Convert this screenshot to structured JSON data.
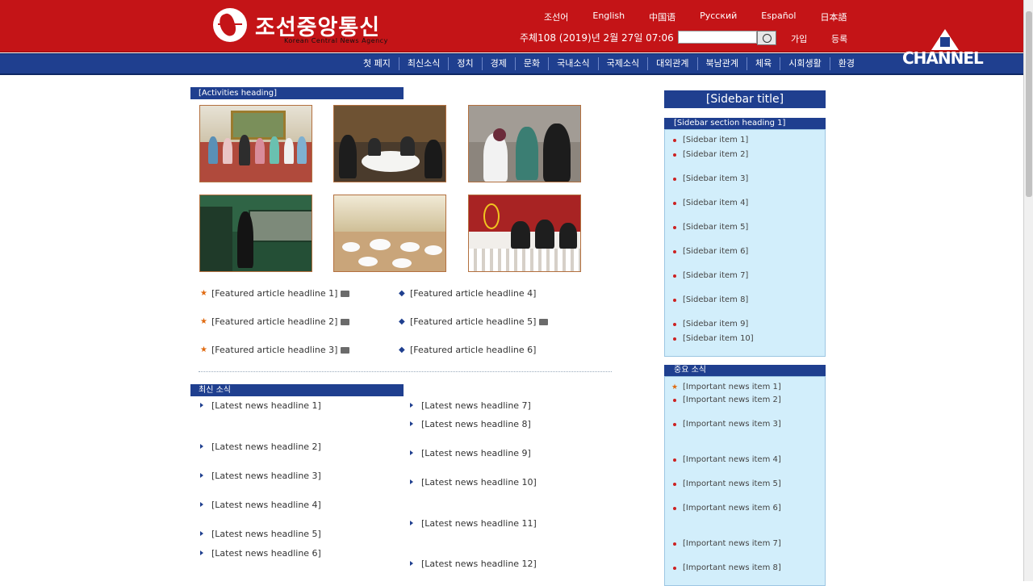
{
  "header": {
    "site_title": "조선중앙통신",
    "site_subtitle": "Korean Central News Agency",
    "languages": [
      "조선어",
      "English",
      "中国语",
      "Русский",
      "Español",
      "日本語"
    ],
    "date": "주체108 (2019)년 2월 27일 07:06",
    "search_placeholder": "",
    "login": "가입",
    "signup": "등록"
  },
  "nav": [
    "첫 페지",
    "최신소식",
    "정치",
    "경제",
    "문화",
    "국내소식",
    "국제소식",
    "대외관계",
    "북남관계",
    "체육",
    "시회생활",
    "환경"
  ],
  "channel_logo": {
    "text": "CHANNEL",
    "mark": "A"
  },
  "featured": {
    "heading": "[Activities heading]",
    "photos": [
      "photo-group",
      "photo-meeting",
      "photo-greeting",
      "photo-train",
      "photo-banquet",
      "photo-podium"
    ],
    "items_left": [
      "[Featured article headline 1]",
      "[Featured article headline 2]",
      "[Featured article headline 3]"
    ],
    "items_right": [
      "[Featured article headline 4]",
      "[Featured article headline 5]",
      "[Featured article headline 6]"
    ]
  },
  "latest": {
    "heading": "최신 소식",
    "items_left": [
      "[Latest news headline 1]",
      "[Latest news headline 2]",
      "[Latest news headline 3]",
      "[Latest news headline 4]",
      "[Latest news headline 5]",
      "[Latest news headline 6]"
    ],
    "items_right": [
      "[Latest news headline 7]",
      "[Latest news headline 8]",
      "[Latest news headline 9]",
      "[Latest news headline 10]",
      "[Latest news headline 11]",
      "[Latest news headline 12]"
    ]
  },
  "sidebar": {
    "title": "[Sidebar title]",
    "section1": {
      "heading": "[Sidebar section heading 1]",
      "items": [
        "[Sidebar item 1]",
        "[Sidebar item 2]",
        "[Sidebar item 3]",
        "[Sidebar item 4]",
        "[Sidebar item 5]",
        "[Sidebar item 6]",
        "[Sidebar item 7]",
        "[Sidebar item 8]",
        "[Sidebar item 9]",
        "[Sidebar item 10]"
      ]
    },
    "section2": {
      "heading": "중요 소식",
      "items": [
        "[Important news item 1]",
        "[Important news item 2]",
        "[Important news item 3]",
        "[Important news item 4]",
        "[Important news item 5]",
        "[Important news item 6]",
        "[Important news item 7]",
        "[Important news item 8]"
      ]
    }
  }
}
